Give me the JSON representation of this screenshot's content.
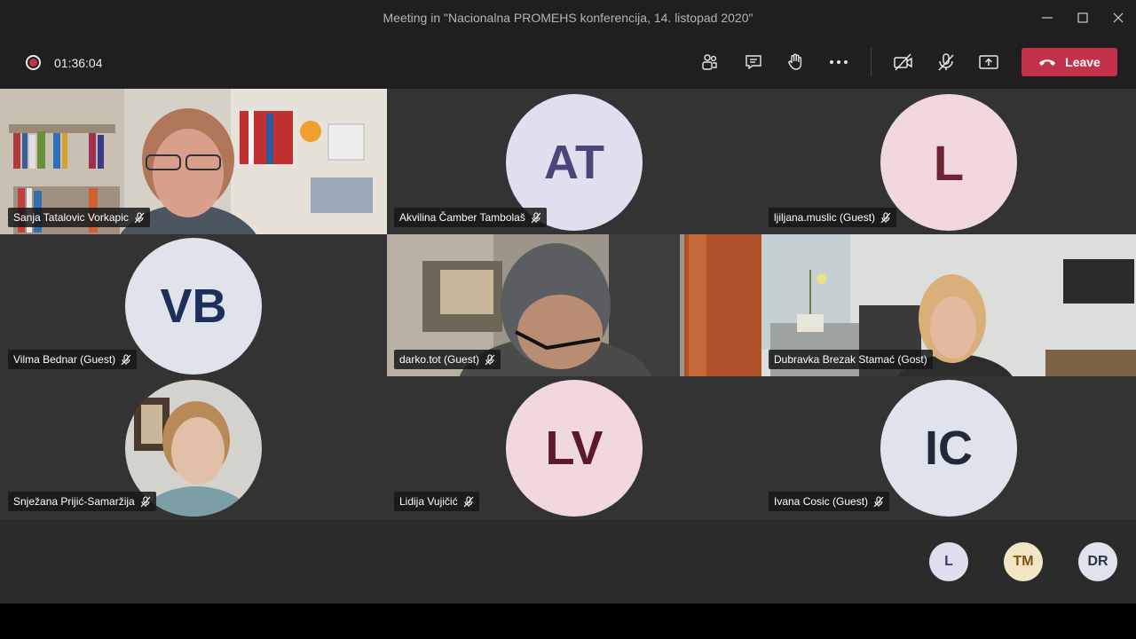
{
  "window": {
    "title": "Meeting in \"Nacionalna PROMEHS konferencija, 14. listopad 2020\""
  },
  "controls": {
    "timer": "01:36:04",
    "leave_label": "Leave"
  },
  "colors": {
    "leave": "#c4314b",
    "avatar_lavender": "#e0dff0",
    "avatar_pink": "#f0d8dd",
    "avatar_blue": "#dfe3ec",
    "avatar_yellow": "#f3e6c5"
  },
  "participants": [
    {
      "name": "Sanja Tatalovic Vorkapic",
      "initials": "",
      "video": true
    },
    {
      "name": "Akvilina Čamber Tambolaš",
      "initials": "AT",
      "video": false
    },
    {
      "name": "ljiljana.muslic (Guest)",
      "initials": "L",
      "video": false
    },
    {
      "name": "Vilma Bednar (Guest)",
      "initials": "VB",
      "video": false
    },
    {
      "name": "darko.tot (Guest)",
      "initials": "",
      "video": true
    },
    {
      "name": "Dubravka Brezak Stamać (Gost)",
      "initials": "",
      "video": true
    },
    {
      "name": "Snježana Prijić-Samaržija",
      "initials": "",
      "video": false,
      "photo": true
    },
    {
      "name": "Lidija Vujičić",
      "initials": "LV",
      "video": false
    },
    {
      "name": "Ivana Cosic (Guest)",
      "initials": "IC",
      "video": false
    }
  ],
  "overflow": [
    {
      "initials": "L"
    },
    {
      "initials": "TM"
    },
    {
      "initials": "DR"
    }
  ]
}
